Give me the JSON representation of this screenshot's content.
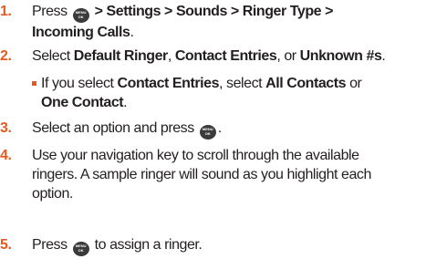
{
  "colors": {
    "accent": "#e9591d",
    "text": "#231f20",
    "key_bg": "#3a3a3a"
  },
  "key_icon": {
    "name": "menu-ok-key-icon",
    "top": "MENU",
    "bottom": "OK"
  },
  "steps": [
    {
      "number": "1.",
      "line1_press": "Press",
      "line1_path": "> Settings > Sounds > Ringer Type >",
      "line2_bold": "Incoming Calls",
      "line2_end": "."
    },
    {
      "number": "2.",
      "select": "Select",
      "opt1": "Default Ringer",
      "sep1": ",",
      "opt2": "Contact Entries",
      "sep2": ", or",
      "opt3": "Unknown #s",
      "end": ".",
      "sub": {
        "pre": "If you select",
        "bold1": "Contact Entries",
        "mid": ", select",
        "bold2": "All Contacts",
        "or": "or",
        "bold3": "One Contact",
        "end": "."
      }
    },
    {
      "number": "3.",
      "text": "Select an option and press",
      "end": "."
    },
    {
      "number": "4.",
      "line1": "Use your navigation key to scroll through the available",
      "line2": "ringers. A sample ringer will sound as you highlight each",
      "line3": "option."
    },
    {
      "number": "5.",
      "pre": "Press",
      "post": "to assign a ringer."
    }
  ]
}
